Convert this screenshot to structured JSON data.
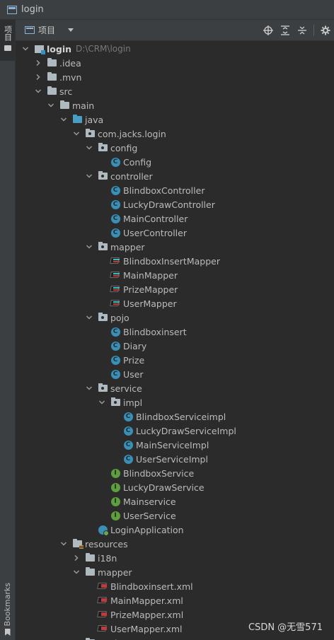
{
  "window": {
    "title": "login"
  },
  "sidestrip": {
    "project_tab": "项目",
    "bookmarks_tab": "Bookmarks"
  },
  "toolbar": {
    "view_label": "项目",
    "tools": [
      "crosshair-icon",
      "expand-all-icon",
      "collapse-all-icon",
      "settings-icon"
    ]
  },
  "tree": [
    {
      "label": "login",
      "path": "D:\\CRM\\login",
      "depth": 0,
      "icon": "module",
      "expanded": true,
      "bold": true
    },
    {
      "label": ".idea",
      "depth": 1,
      "icon": "folder",
      "expanded": false
    },
    {
      "label": ".mvn",
      "depth": 1,
      "icon": "folder",
      "expanded": false
    },
    {
      "label": "src",
      "depth": 1,
      "icon": "folder",
      "expanded": true
    },
    {
      "label": "main",
      "depth": 2,
      "icon": "folder",
      "expanded": true
    },
    {
      "label": "java",
      "depth": 3,
      "icon": "folder-blue",
      "expanded": true
    },
    {
      "label": "com.jacks.login",
      "depth": 4,
      "icon": "package",
      "expanded": true
    },
    {
      "label": "config",
      "depth": 5,
      "icon": "package",
      "expanded": true
    },
    {
      "label": "Config",
      "depth": 6,
      "icon": "class"
    },
    {
      "label": "controller",
      "depth": 5,
      "icon": "package",
      "expanded": true
    },
    {
      "label": "BlindboxController",
      "depth": 6,
      "icon": "class"
    },
    {
      "label": "LuckyDrawController",
      "depth": 6,
      "icon": "class"
    },
    {
      "label": "MainController",
      "depth": 6,
      "icon": "class"
    },
    {
      "label": "UserController",
      "depth": 6,
      "icon": "class"
    },
    {
      "label": "mapper",
      "depth": 5,
      "icon": "package",
      "expanded": true
    },
    {
      "label": "BlindboxInsertMapper",
      "depth": 6,
      "icon": "mapper"
    },
    {
      "label": "MainMapper",
      "depth": 6,
      "icon": "mapper"
    },
    {
      "label": "PrizeMapper",
      "depth": 6,
      "icon": "mapper"
    },
    {
      "label": "UserMapper",
      "depth": 6,
      "icon": "mapper"
    },
    {
      "label": "pojo",
      "depth": 5,
      "icon": "package",
      "expanded": true
    },
    {
      "label": "Blindboxinsert",
      "depth": 6,
      "icon": "class"
    },
    {
      "label": "Diary",
      "depth": 6,
      "icon": "class"
    },
    {
      "label": "Prize",
      "depth": 6,
      "icon": "class"
    },
    {
      "label": "User",
      "depth": 6,
      "icon": "class"
    },
    {
      "label": "service",
      "depth": 5,
      "icon": "package",
      "expanded": true
    },
    {
      "label": "impl",
      "depth": 6,
      "icon": "package",
      "expanded": true
    },
    {
      "label": "BlindboxServiceimpl",
      "depth": 7,
      "icon": "class"
    },
    {
      "label": "LuckyDrawServiceImpl",
      "depth": 7,
      "icon": "class"
    },
    {
      "label": "MainServiceImpl",
      "depth": 7,
      "icon": "class"
    },
    {
      "label": "UserServiceImpl",
      "depth": 7,
      "icon": "class"
    },
    {
      "label": "BlindboxService",
      "depth": 6,
      "icon": "interface"
    },
    {
      "label": "LuckyDrawService",
      "depth": 6,
      "icon": "interface"
    },
    {
      "label": "Mainservice",
      "depth": 6,
      "icon": "interface"
    },
    {
      "label": "UserService",
      "depth": 6,
      "icon": "interface"
    },
    {
      "label": "LoginApplication",
      "depth": 5,
      "icon": "app"
    },
    {
      "label": "resources",
      "depth": 3,
      "icon": "folder-res",
      "expanded": true
    },
    {
      "label": "i18n",
      "depth": 4,
      "icon": "folder",
      "expanded": false
    },
    {
      "label": "mapper",
      "depth": 4,
      "icon": "folder",
      "expanded": true
    },
    {
      "label": "Blindboxinsert.xml",
      "depth": 5,
      "icon": "xml"
    },
    {
      "label": "MainMapper.xml",
      "depth": 5,
      "icon": "xml"
    },
    {
      "label": "PrizeMapper.xml",
      "depth": 5,
      "icon": "xml"
    },
    {
      "label": "UserMapper.xml",
      "depth": 5,
      "icon": "xml"
    },
    {
      "label": "static",
      "depth": 4,
      "icon": "folder",
      "expanded": false
    }
  ],
  "watermark": "CSDN @无雪571"
}
